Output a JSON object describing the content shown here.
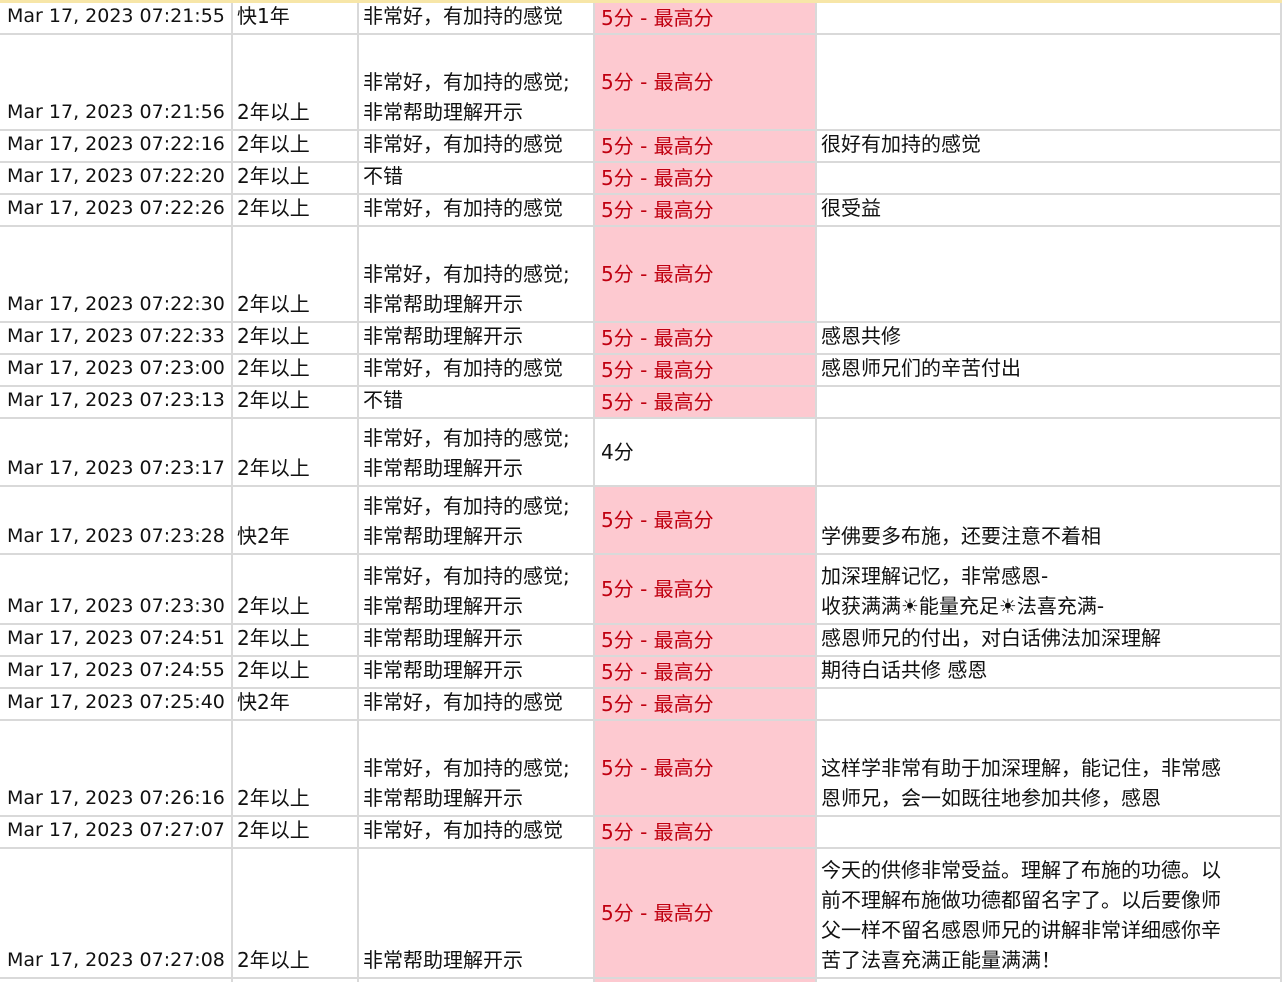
{
  "colors": {
    "highlight_bg": "#fdc9d0",
    "highlight_text": "#c00010",
    "grid_line": "#d9d9d9",
    "header_strip": "#f7e6a8"
  },
  "rows": [
    {
      "ts": "Mar 17, 2023 07:21:55",
      "duration": "快1年",
      "feeling": "非常好，有加持的感觉",
      "rating": "5分 - 最高分",
      "comment": ""
    },
    {
      "ts": "Mar 17, 2023 07:21:56",
      "duration": "2年以上",
      "feeling": "非常好，有加持的感觉;\n非常帮助理解开示",
      "rating": "5分 - 最高分",
      "comment": ""
    },
    {
      "ts": "Mar 17, 2023 07:22:16",
      "duration": "2年以上",
      "feeling": "非常好，有加持的感觉",
      "rating": "5分 - 最高分",
      "comment": "很好有加持的感觉"
    },
    {
      "ts": "Mar 17, 2023 07:22:20",
      "duration": "2年以上",
      "feeling": "不错",
      "rating": "5分 - 最高分",
      "comment": ""
    },
    {
      "ts": "Mar 17, 2023 07:22:26",
      "duration": "2年以上",
      "feeling": "非常好，有加持的感觉",
      "rating": "5分 - 最高分",
      "comment": "很受益"
    },
    {
      "ts": "Mar 17, 2023 07:22:30",
      "duration": "2年以上",
      "feeling": "非常好，有加持的感觉;\n非常帮助理解开示",
      "rating": "5分 - 最高分",
      "comment": ""
    },
    {
      "ts": "Mar 17, 2023 07:22:33",
      "duration": "2年以上",
      "feeling": "非常帮助理解开示",
      "rating": "5分 - 最高分",
      "comment": "感恩共修"
    },
    {
      "ts": "Mar 17, 2023 07:23:00",
      "duration": "2年以上",
      "feeling": "非常好，有加持的感觉",
      "rating": "5分 - 最高分",
      "comment": "感恩师兄们的辛苦付出"
    },
    {
      "ts": "Mar 17, 2023 07:23:13",
      "duration": "2年以上",
      "feeling": "不错",
      "rating": "5分 - 最高分",
      "comment": ""
    },
    {
      "ts": "Mar 17, 2023 07:23:17",
      "duration": "2年以上",
      "feeling": "非常好，有加持的感觉;\n非常帮助理解开示",
      "rating": "4分",
      "comment": ""
    },
    {
      "ts": "Mar 17, 2023 07:23:28",
      "duration": "快2年",
      "feeling": "非常好，有加持的感觉;\n非常帮助理解开示",
      "rating": "5分 - 最高分",
      "comment": "学佛要多布施，还要注意不着相"
    },
    {
      "ts": "Mar 17, 2023 07:23:30",
      "duration": "2年以上",
      "feeling": "非常好，有加持的感觉;\n非常帮助理解开示",
      "rating": "5分 - 最高分",
      "comment": "加深理解记忆，非常感恩-\n收获满满☀能量充足☀法喜充满-"
    },
    {
      "ts": "Mar 17, 2023 07:24:51",
      "duration": "2年以上",
      "feeling": "非常帮助理解开示",
      "rating": "5分 - 最高分",
      "comment": "感恩师兄的付出，对白话佛法加深理解"
    },
    {
      "ts": "Mar 17, 2023 07:24:55",
      "duration": "2年以上",
      "feeling": "非常帮助理解开示",
      "rating": "5分 - 最高分",
      "comment": "期待白话共修 感恩"
    },
    {
      "ts": "Mar 17, 2023 07:25:40",
      "duration": "快2年",
      "feeling": "非常好，有加持的感觉",
      "rating": "5分 - 最高分",
      "comment": ""
    },
    {
      "ts": "Mar 17, 2023 07:26:16",
      "duration": "2年以上",
      "feeling": "非常好，有加持的感觉;\n非常帮助理解开示",
      "rating": "5分 - 最高分",
      "comment": "这样学非常有助于加深理解，能记住，非常感\n恩师兄，会一如既往地参加共修，感恩"
    },
    {
      "ts": "Mar 17, 2023 07:27:07",
      "duration": "2年以上",
      "feeling": "非常好，有加持的感觉",
      "rating": "5分 - 最高分",
      "comment": ""
    },
    {
      "ts": "Mar 17, 2023 07:27:08",
      "duration": "2年以上",
      "feeling": "非常帮助理解开示",
      "rating": "5分 - 最高分",
      "comment": "今天的供修非常受益。理解了布施的功德。以\n前不理解布施做功德都留名字了。以后要像师\n父一样不留名感恩师兄的讲解非常详细感你辛\n苦了法喜充满正能量满满！"
    }
  ]
}
